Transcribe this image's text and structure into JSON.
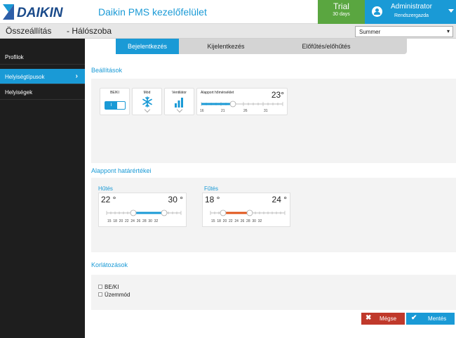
{
  "header": {
    "logo_text": "DAIKIN",
    "app_title": "Daikin PMS kezelőfelület",
    "trial_label": "Trial",
    "trial_days": "30 days",
    "user_name": "Administrator",
    "user_role": "Rendszergazda"
  },
  "subbar": {
    "crumb_root": "Összeállítás",
    "crumb_page": "- Hálószoba",
    "season_select": "Summer"
  },
  "sidebar": {
    "items": [
      {
        "label": "Profilok"
      },
      {
        "label": "Helyiségtípusok"
      },
      {
        "label": "Helyiségek"
      }
    ]
  },
  "tabs": [
    {
      "label": "Bejelentkezés"
    },
    {
      "label": "Kijelentkezés"
    },
    {
      "label": "Előfűtés/előhűtés"
    }
  ],
  "settings": {
    "title": "Beállítások",
    "onoff_label": "BE/KI",
    "onoff_state": "I",
    "mode_label": "Mód",
    "fan_label": "Ventilátor",
    "setpoint_label": "Alapport hőmérséklet",
    "setpoint_value": "23°",
    "setpoint_ticks": [
      "16",
      "21",
      "26",
      "31"
    ]
  },
  "limits": {
    "title": "Alappont határértékei",
    "cooling_label": "Hűtés",
    "cooling_min": "22 °",
    "cooling_max": "30 °",
    "heating_label": "Fűtés",
    "heating_min": "18 °",
    "heating_max": "24 °",
    "scale_ticks": "15  18  20  22  24  26  28  30  32"
  },
  "restrictions": {
    "title": "Korlátozások",
    "items": [
      {
        "label": "BE/KI"
      },
      {
        "label": "Üzemmód"
      }
    ]
  },
  "buttons": {
    "cancel": "Mégse",
    "save": "Mentés"
  },
  "colors": {
    "accent": "#1a9ad6",
    "trial": "#5aa640",
    "heating": "#e0561b",
    "cancel": "#c0392b"
  }
}
